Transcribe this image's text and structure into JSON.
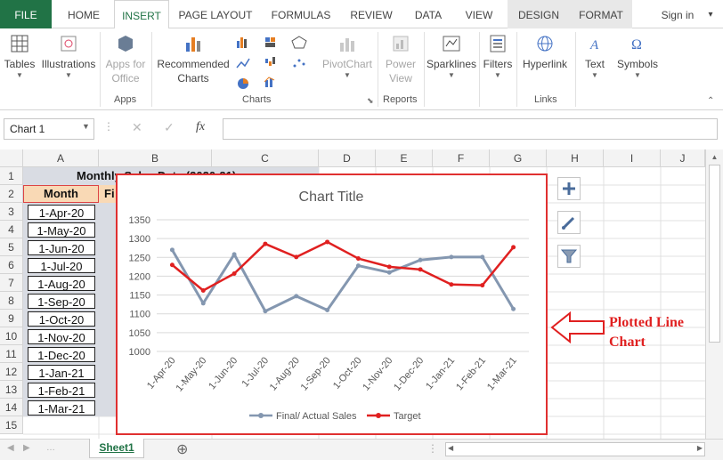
{
  "tabs": {
    "file": "FILE",
    "home": "HOME",
    "insert": "INSERT",
    "page_layout": "PAGE LAYOUT",
    "formulas": "FORMULAS",
    "review": "REVIEW",
    "data": "DATA",
    "view": "VIEW",
    "design": "DESIGN",
    "format": "FORMAT",
    "signin": "Sign in"
  },
  "ribbon": {
    "tables": "Tables",
    "illustrations": "Illustrations",
    "apps_for_office_1": "Apps for",
    "apps_for_office_2": "Office",
    "apps_group": "Apps",
    "recommended_1": "Recommended",
    "recommended_2": "Charts",
    "charts_group": "Charts",
    "pivotchart": "PivotChart",
    "power_view_1": "Power",
    "power_view_2": "View",
    "reports_group": "Reports",
    "sparklines": "Sparklines",
    "filters": "Filters",
    "hyperlink": "Hyperlink",
    "links_group": "Links",
    "text": "Text",
    "symbols": "Symbols"
  },
  "formula_bar": {
    "name_box": "Chart 1",
    "fx": "fx",
    "cancel": "✕",
    "enter": "✓",
    "formula": ""
  },
  "columns": [
    "A",
    "B",
    "C",
    "D",
    "E",
    "F",
    "G",
    "H",
    "I",
    "J"
  ],
  "rows": [
    "1",
    "2",
    "3",
    "4",
    "5",
    "6",
    "7",
    "8",
    "9",
    "10",
    "11",
    "12",
    "13",
    "14",
    "15"
  ],
  "sheet": {
    "title": "Monthly Sales Data (2020-21)",
    "header_month": "Month",
    "header_b": "Fi",
    "months": [
      "1-Apr-20",
      "1-May-20",
      "1-Jun-20",
      "1-Jul-20",
      "1-Aug-20",
      "1-Sep-20",
      "1-Oct-20",
      "1-Nov-20",
      "1-Dec-20",
      "1-Jan-21",
      "1-Feb-21",
      "1-Mar-21"
    ]
  },
  "chart_data": {
    "type": "line",
    "title": "Chart Title",
    "categories": [
      "1-Apr-20",
      "1-May-20",
      "1-Jun-20",
      "1-Jul-20",
      "1-Aug-20",
      "1-Sep-20",
      "1-Oct-20",
      "1-Nov-20",
      "1-Dec-20",
      "1-Jan-21",
      "1-Feb-21",
      "1-Mar-21"
    ],
    "series": [
      {
        "name": "Final/ Actual Sales",
        "color": "#8497b0",
        "values": [
          1270,
          1128,
          1258,
          1107,
          1147,
          1110,
          1228,
          1210,
          1243,
          1251,
          1251,
          1113
        ]
      },
      {
        "name": "Target",
        "color": "#e02020",
        "values": [
          1230,
          1162,
          1207,
          1286,
          1251,
          1291,
          1247,
          1225,
          1218,
          1178,
          1176,
          1277
        ]
      }
    ],
    "ylim": [
      1000,
      1350
    ],
    "yticks": [
      1000,
      1050,
      1100,
      1150,
      1200,
      1250,
      1300,
      1350
    ],
    "grid": true,
    "legend": "bottom"
  },
  "annotation": {
    "line1": "Plotted Line",
    "line2": "Chart"
  },
  "sheet_tab": "Sheet1",
  "add_sheet": "⊕"
}
